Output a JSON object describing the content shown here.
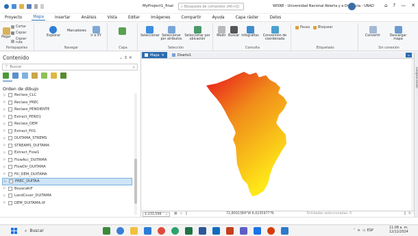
{
  "titlebar": {
    "project": "MyProject1_final",
    "search_placeholder": "Búsqueda de comandos (Alt+Q)",
    "user": "WISNE - Universidad Nacional Abierta y a Distancia - UNAD",
    "help": "?",
    "minimize": "—",
    "close": "✕"
  },
  "ribbon_tabs": [
    "Proyecto",
    "Mapa",
    "Insertar",
    "Análisis",
    "Vista",
    "Editar",
    "Imágenes",
    "Compartir",
    "Ayuda",
    "Capa ráster",
    "Datos"
  ],
  "ribbon": {
    "clipboard": {
      "cortar": "Cortar",
      "copiar": "Copiar",
      "pegar": "Pegar",
      "copiar_ruta": "Copiar ruta",
      "label": "Portapapeles"
    },
    "navigate": {
      "explorar": "Explorar",
      "marcadores": "Marcadores",
      "ir_xy": "Ir a XY",
      "label": "Navegar"
    },
    "layer": {
      "label": "Capa"
    },
    "selection": {
      "seleccionar": "Seleccionar",
      "por_atributos": "Seleccionar por atributos",
      "por_ubicacion": "Seleccionar por ubicación",
      "label": "Selección"
    },
    "inquiry": {
      "medir": "Medir",
      "buscar": "Buscar",
      "infografias": "Infografías",
      "conversion": "Conversión de coordenada",
      "label": "Consulta"
    },
    "labeling": {
      "pausa": "Pausa",
      "bloquear": "Bloquear",
      "label": "Etiquetado"
    },
    "offline": {
      "convertir": "Convertir",
      "descargar": "Descargar mapa",
      "label": "Sin conexión"
    }
  },
  "contents": {
    "title": "Contenido",
    "pane_ctrls": "⌄ ⇕ ✕",
    "search_placeholder": "Buscar",
    "drawing_order": "Orden de dibujo",
    "layers": [
      {
        "name": "Reclass_CLC",
        "checked": false
      },
      {
        "name": "Reclass_PREC",
        "checked": false
      },
      {
        "name": "Reclass_PENDIENTE",
        "checked": false
      },
      {
        "name": "Extract_PEND1",
        "checked": false
      },
      {
        "name": "Reclass_DEM",
        "checked": false
      },
      {
        "name": "Extract_Fill1",
        "checked": false
      },
      {
        "name": "DUITAMA_STREMS",
        "checked": false
      },
      {
        "name": "STREAMS_DUITAMA",
        "checked": false
      },
      {
        "name": "Extract_Flow1",
        "checked": false
      },
      {
        "name": "FlowAcc_DUITAMA",
        "checked": false
      },
      {
        "name": "FlowDir_DUITAMA",
        "checked": false
      },
      {
        "name": "Fill_DEM_DUITAMA",
        "checked": false
      },
      {
        "name": "PREC_DUITAA",
        "checked": true,
        "selected": true
      },
      {
        "name": "BoyacaKiF",
        "checked": false
      },
      {
        "name": "LandCover_DUITAMA",
        "checked": false
      },
      {
        "name": "DEM_DUITAMA.tif",
        "checked": false
      }
    ]
  },
  "map": {
    "tab_active": "Mapa",
    "tab_close": "✕",
    "tab_layout": "Diseño1",
    "scale": "1:233,596",
    "coords": "72,8002384°W 6,0235977°N",
    "selected_features": "Entidades seleccionadas: 0",
    "gradient_colors": [
      "#e8141c",
      "#f08a1a",
      "#ffe818"
    ]
  },
  "right_rail": "Geoprocesam",
  "taskbar": {
    "search": "Buscar",
    "language": "ESP",
    "time": "11:08 a. m.",
    "date": "12/12/2024"
  }
}
